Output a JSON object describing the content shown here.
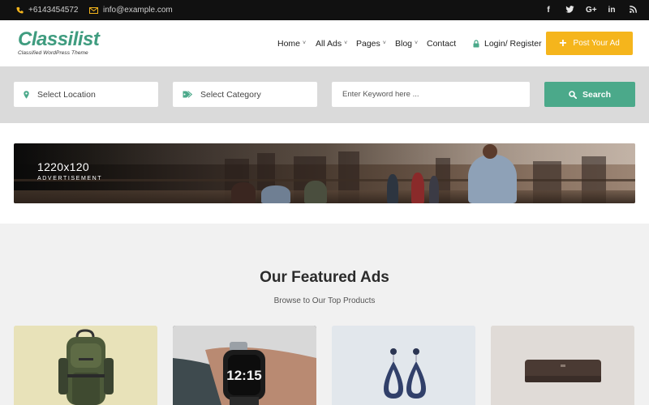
{
  "topbar": {
    "phone": "+6143454572",
    "email": "info@example.com",
    "social": [
      {
        "icon": "facebook-icon",
        "glyph": "f"
      },
      {
        "icon": "twitter-icon",
        "glyph": "🐦"
      },
      {
        "icon": "google-plus-icon",
        "glyph": "G+"
      },
      {
        "icon": "linkedin-icon",
        "glyph": "in"
      },
      {
        "icon": "rss-icon",
        "glyph": "☰"
      }
    ]
  },
  "header": {
    "logo_name": "Classilist",
    "logo_tagline": "Classified WordPress Theme",
    "nav": [
      {
        "label": "Home",
        "has_dropdown": true
      },
      {
        "label": "All Ads",
        "has_dropdown": true
      },
      {
        "label": "Pages",
        "has_dropdown": true
      },
      {
        "label": "Blog",
        "has_dropdown": true
      },
      {
        "label": "Contact",
        "has_dropdown": false
      }
    ],
    "login_label": "Login/ Register",
    "post_ad_label": "Post Your Ad"
  },
  "search": {
    "location_label": "Select Location",
    "category_label": "Select Category",
    "keyword_placeholder": "Enter Keyword here ...",
    "button_label": "Search"
  },
  "banner": {
    "size_text": "1220x120",
    "label": "ADVERTISEMENT"
  },
  "featured": {
    "title": "Our Featured Ads",
    "subtitle": "Browse to Our Top Products",
    "cards": [
      {
        "name": "backpack-product",
        "bg": "#e6e0b4"
      },
      {
        "name": "smartwatch-product",
        "bg": "#2a2a2a"
      },
      {
        "name": "earrings-product",
        "bg": "#dfe5ea"
      },
      {
        "name": "air-conditioner-product",
        "bg": "#dedad6"
      }
    ],
    "watch_time": "12:15"
  },
  "colors": {
    "accent_green": "#4ba98a",
    "accent_yellow": "#f5b51c",
    "topbar_bg": "#111111"
  }
}
